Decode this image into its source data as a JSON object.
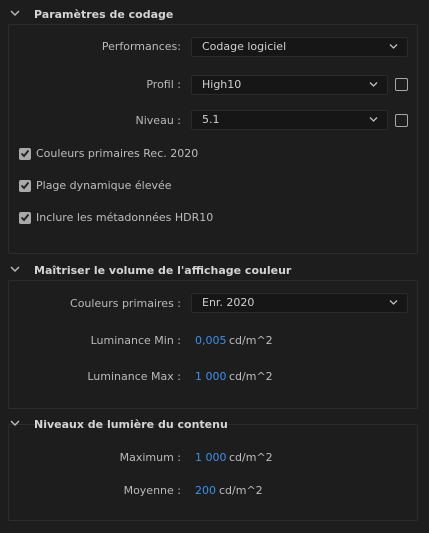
{
  "encoding": {
    "title": "Paramètres de codage",
    "performance": {
      "label": "Performances:",
      "value": "Codage logiciel"
    },
    "profile": {
      "label": "Profil :",
      "value": "High10"
    },
    "level": {
      "label": "Niveau :",
      "value": "5.1"
    },
    "checkboxes": [
      {
        "label": "Couleurs primaires Rec. 2020",
        "checked": true
      },
      {
        "label": "Plage dynamique élevée",
        "checked": true
      },
      {
        "label": "Inclure les métadonnées HDR10",
        "checked": true
      }
    ]
  },
  "mastering": {
    "title": "Maîtriser le volume de l'affichage couleur",
    "primaries": {
      "label": "Couleurs primaires :",
      "value": "Enr. 2020"
    },
    "lum_min": {
      "label": "Luminance Min :",
      "value": "0,005",
      "unit": "cd/m^2"
    },
    "lum_max": {
      "label": "Luminance Max :",
      "value": "1 000",
      "unit": "cd/m^2"
    }
  },
  "content_light": {
    "title": "Niveaux de lumière du contenu",
    "maximum": {
      "label": "Maximum :",
      "value": "1 000",
      "unit": "cd/m^2"
    },
    "average": {
      "label": "Moyenne :",
      "value": "200",
      "unit": "cd/m^2"
    }
  },
  "colors": {
    "accent": "#3b8fe8",
    "background": "#1d1d1d"
  }
}
